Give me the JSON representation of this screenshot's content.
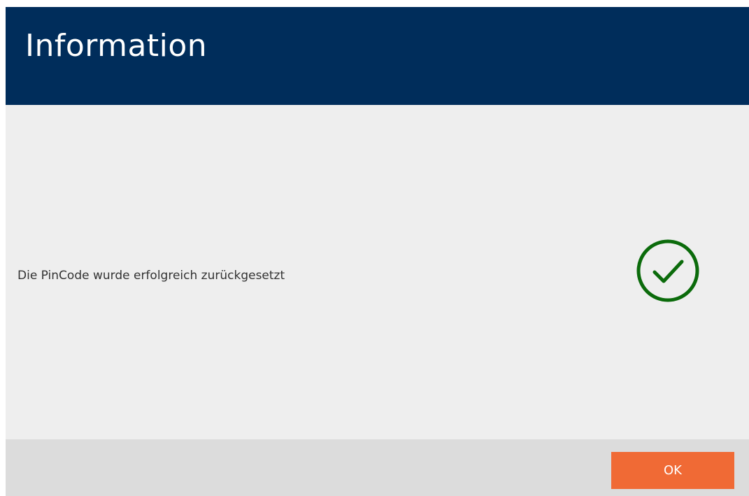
{
  "dialog": {
    "title": "Information",
    "message": "Die PinCode wurde erfolgreich zurückgesetzt",
    "status_icon": "check-circle-icon",
    "ok_label": "OK"
  },
  "colors": {
    "header": "#002d5b",
    "body": "#eeeeee",
    "footer": "#dcdcdc",
    "ok_button": "#f06a35",
    "success_icon": "#0b6b0b"
  }
}
